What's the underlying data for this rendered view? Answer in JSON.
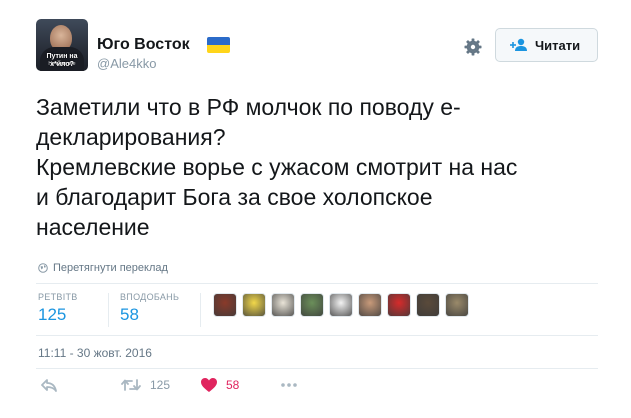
{
  "author": {
    "name": "Юго Восток",
    "handle": "@Ale4kko",
    "avatar_caption_line1": "Путин на х*йло?",
    "avatar_caption_line2": "Ну а вы все"
  },
  "follow_button": {
    "label": "Читати",
    "icon": "add-user-icon"
  },
  "settings_icon": "gear-icon",
  "tweet": {
    "lines": [
      "Заметили что в РФ молчок по поводу е-",
      "декларирования?",
      "Кремлевские ворье с ужасом смотрит на нас",
      "и благодарит Бога за свое холопское",
      "население"
    ]
  },
  "translate": {
    "label": "Перетягнути переклад",
    "icon": "globe-icon"
  },
  "stats": {
    "retweets_label": "РЕТВІТВ",
    "retweets_value": "125",
    "likes_label": "ВПОДОБАНЬ",
    "likes_value": "58"
  },
  "likers": [
    {
      "name": "liker-avatar-1",
      "color": "#8a3a2a"
    },
    {
      "name": "liker-avatar-2",
      "color": "#f2d84a"
    },
    {
      "name": "liker-avatar-3",
      "color": "#e9e4d8"
    },
    {
      "name": "liker-avatar-4",
      "color": "#6b8f5a"
    },
    {
      "name": "liker-avatar-5",
      "color": "#f3f3f3"
    },
    {
      "name": "liker-avatar-6",
      "color": "#c89a7a"
    },
    {
      "name": "liker-avatar-7",
      "color": "#d62b2b"
    },
    {
      "name": "liker-avatar-8",
      "color": "#5a4a3a"
    },
    {
      "name": "liker-avatar-9",
      "color": "#9a8a6a"
    }
  ],
  "timestamp": "11:11 - 30 жовт. 2016",
  "actions": {
    "reply_icon": "reply-icon",
    "retweet_icon": "retweet-icon",
    "retweet_count": "125",
    "like_icon": "heart-icon",
    "like_count": "58",
    "more_icon": "more-icon"
  },
  "colors": {
    "accent": "#1b95e0",
    "like": "#e0245e",
    "muted": "#8899a6"
  }
}
